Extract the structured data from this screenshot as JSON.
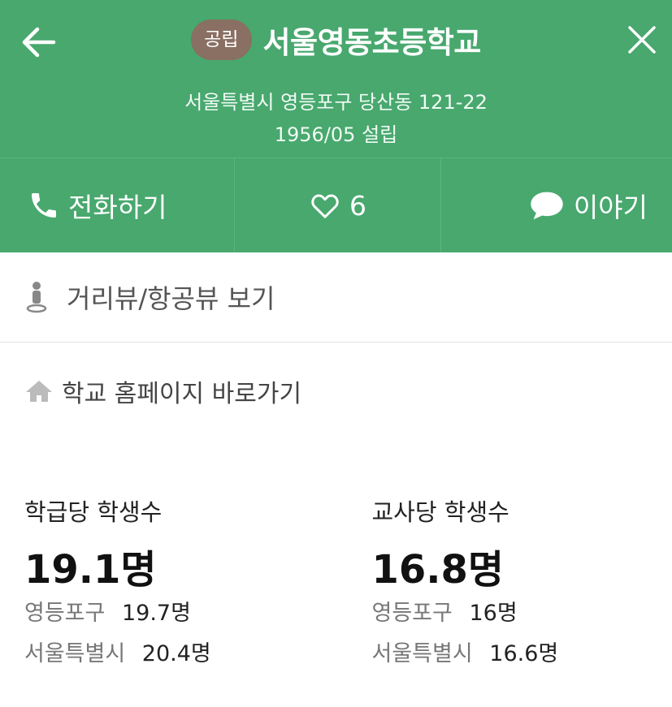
{
  "header": {
    "badge": "공립",
    "school_name": "서울영동초등학교",
    "address": "서울특별시 영등포구 당산동 121-22",
    "founded": "1956/05 설립"
  },
  "actions": {
    "call_label": "전화하기",
    "like_count": "6",
    "talk_label": "이야기"
  },
  "links": {
    "streetview_label": "거리뷰/항공뷰 보기",
    "homepage_label": "학교 홈페이지 바로가기"
  },
  "stats": [
    {
      "label": "학급당 학생수",
      "value": "19.1명",
      "rows": [
        {
          "region": "영등포구",
          "value": "19.7명"
        },
        {
          "region": "서울특별시",
          "value": "20.4명"
        }
      ]
    },
    {
      "label": "교사당 학생수",
      "value": "16.8명",
      "rows": [
        {
          "region": "영등포구",
          "value": "16명"
        },
        {
          "region": "서울특별시",
          "value": "16.6명"
        }
      ]
    }
  ],
  "colors": {
    "header_green": "#48a86e",
    "badge_brown": "#8a6f63"
  },
  "icons": [
    "back-arrow-icon",
    "close-icon",
    "phone-icon",
    "heart-icon",
    "speech-bubble-icon",
    "pegman-icon",
    "home-icon"
  ]
}
